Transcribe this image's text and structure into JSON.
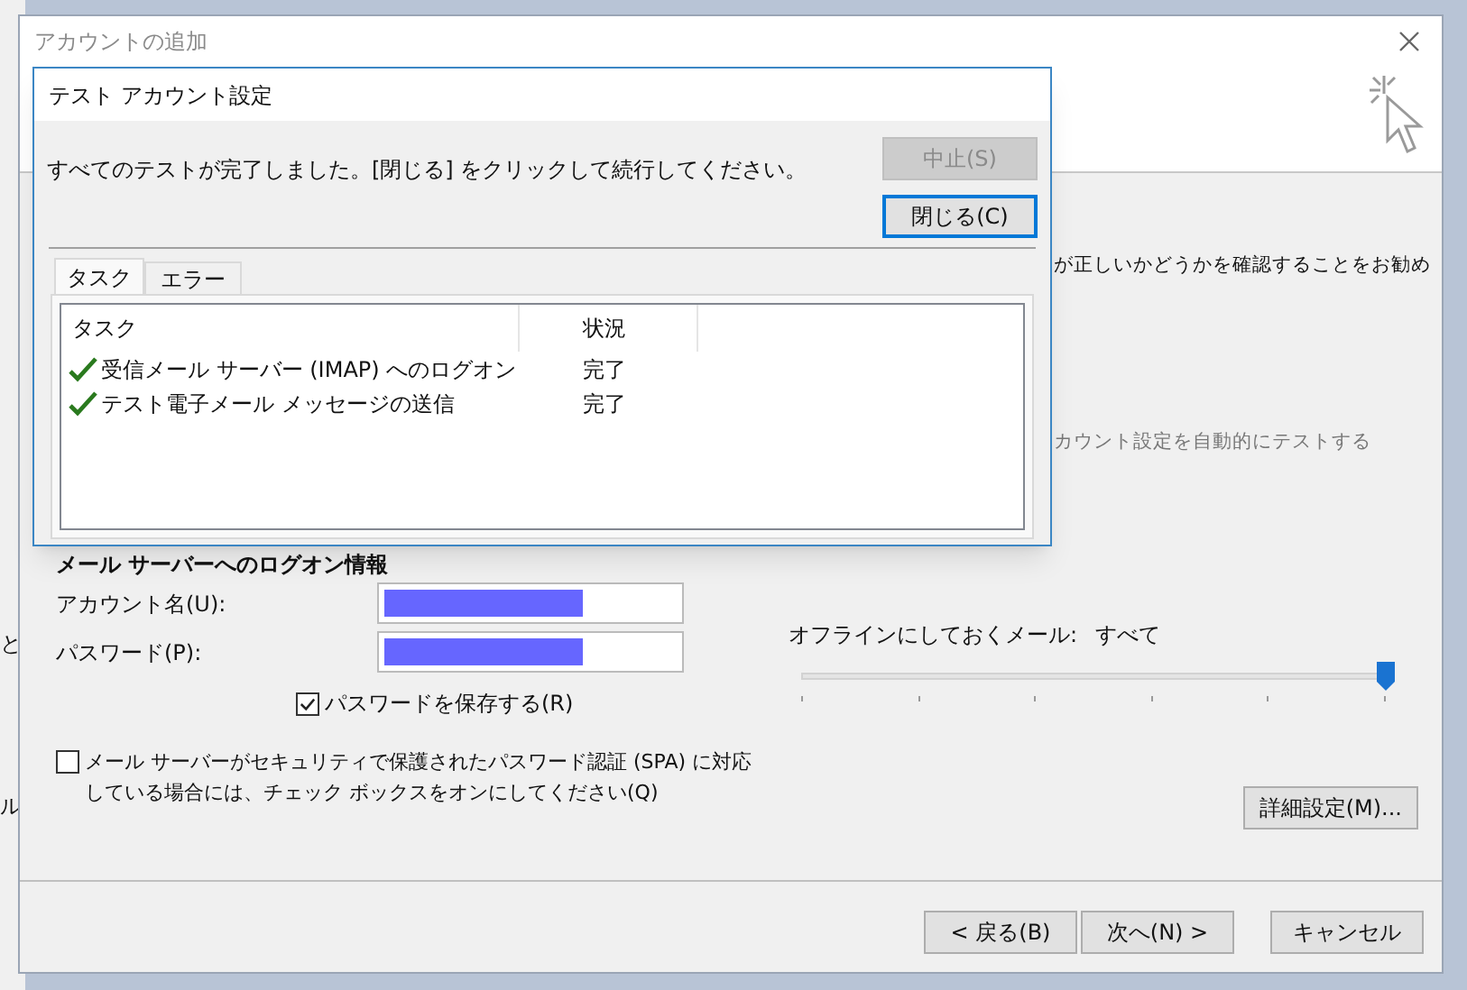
{
  "background_app": {
    "fragments": [
      "と",
      "ル"
    ]
  },
  "window": {
    "title": "アカウントの追加"
  },
  "body": {
    "hidden_texts": [
      "が正しいかどうかを確認することをお勧め",
      "カウント設定を自動的にテストする"
    ],
    "section_heading": "メール サーバーへのログオン情報",
    "fields": [
      {
        "label": "アカウント名(U):"
      },
      {
        "label": "パスワード(P):"
      }
    ],
    "remember_password": {
      "label": "パスワードを保存する(R)",
      "checked": true
    },
    "spa": {
      "label": "メール サーバーがセキュリティで保護されたパスワード認証 (SPA) に対応している場合には、チェック ボックスをオンにしてください(Q)",
      "checked": false
    },
    "offline": {
      "label": "オフラインにしておくメール:",
      "value": "すべて",
      "level": 1
    },
    "advanced_button": "詳細設定(M)...",
    "buttons": [
      {
        "label": "< 戻る(B)"
      },
      {
        "label": "次へ(N) >"
      },
      {
        "label": "キャンセル"
      }
    ]
  },
  "dialog": {
    "title": "テスト アカウント設定",
    "message": "すべてのテストが完了しました。[閉じる] をクリックして続行してください。",
    "buttons": [
      {
        "label": "中止(S)",
        "disabled": true
      },
      {
        "label": "閉じる(C)",
        "disabled": false
      }
    ],
    "tabs": [
      {
        "label": "タスク",
        "selected": true
      },
      {
        "label": "エラー",
        "selected": false
      }
    ],
    "columns": [
      "タスク",
      "状況"
    ],
    "rows": [
      {
        "task": "受信メール サーバー (IMAP) へのログオン",
        "status": "完了",
        "done": true
      },
      {
        "task": "テスト電子メール メッセージの送信",
        "status": "完了",
        "done": true
      }
    ]
  }
}
